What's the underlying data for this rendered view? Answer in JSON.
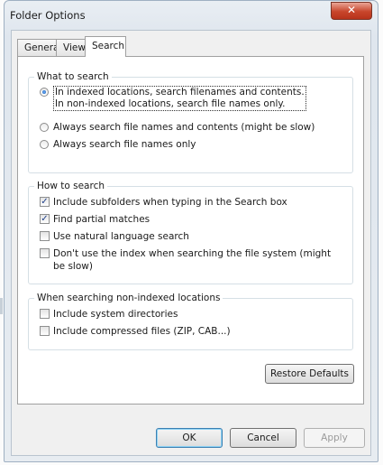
{
  "window": {
    "title": "Folder Options",
    "close_glyph": "✕"
  },
  "tabs": [
    {
      "label": "General"
    },
    {
      "label": "View"
    },
    {
      "label": "Search",
      "active": true
    }
  ],
  "what_to_search": {
    "legend": "What to search",
    "options": [
      {
        "line1": "In indexed locations, search filenames and contents.",
        "line2": "In non-indexed locations, search file names only.",
        "selected": true
      },
      {
        "label": "Always search file names and contents (might be slow)",
        "selected": false
      },
      {
        "label": "Always search file names only",
        "selected": false
      }
    ]
  },
  "how_to_search": {
    "legend": "How to search",
    "options": [
      {
        "label": "Include subfolders when typing in the Search box",
        "checked": true
      },
      {
        "label": "Find partial matches",
        "checked": true
      },
      {
        "label": "Use natural language search",
        "checked": false
      },
      {
        "line1": "Don't use the index when searching the file system (might",
        "line2": "be slow)",
        "checked": false
      }
    ]
  },
  "non_indexed": {
    "legend": "When searching non-indexed locations",
    "options": [
      {
        "label": "Include system directories",
        "checked": false
      },
      {
        "label": "Include compressed files (ZIP, CAB...)",
        "checked": false
      }
    ]
  },
  "buttons": {
    "restore_defaults": "Restore Defaults",
    "ok": "OK",
    "cancel": "Cancel",
    "apply": "Apply"
  },
  "check_glyph": "✓"
}
